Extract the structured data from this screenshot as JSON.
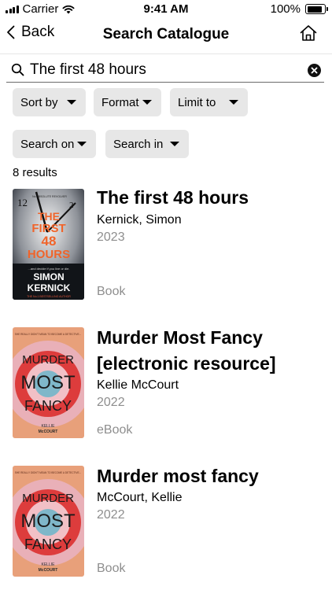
{
  "status_bar": {
    "carrier": "Carrier",
    "time": "9:41 AM",
    "battery": "100%",
    "battery_level": 1.0
  },
  "nav": {
    "back_label": "Back",
    "title": "Search Catalogue"
  },
  "search": {
    "value": "The first 48 hours",
    "placeholder": ""
  },
  "filters": {
    "sort_by": "Sort by",
    "format": "Format",
    "limit_to": "Limit to",
    "search_on": "Search on",
    "search_in": "Search in"
  },
  "results_count": "8 results",
  "results": [
    {
      "title": "The first 48 hours",
      "author": "Kernick, Simon",
      "year": "2023",
      "format": "Book",
      "cover": {
        "top_tagline": "No ABSOLUTE REVOLVER",
        "title_lines": [
          "THE",
          "FIRST",
          "48",
          "HOURS"
        ],
        "tagline": "...and decide if you live or die.",
        "author_lines": [
          "SIMON",
          "KERNICK"
        ],
        "footer": "THE No.1 BESTSELLING AUTHOR",
        "title_color": "#f0642a"
      }
    },
    {
      "title": "Murder Most Fancy [electronic resource]",
      "author": "Kellie McCourt",
      "year": "2022",
      "format": "eBook",
      "cover": {
        "top_tagline": "SHE REALLY DIDN'T MEAN TO BECOME A DETECTIVE...",
        "title_lines": [
          "MURDER",
          "MOST",
          "FANCY"
        ],
        "author_lines": [
          "KELLIE",
          "McCOURT"
        ]
      }
    },
    {
      "title": "Murder most fancy",
      "author": "McCourt, Kellie",
      "year": "2022",
      "format": "Book",
      "cover": {
        "top_tagline": "SHE REALLY DIDN'T MEAN TO BECOME A DETECTIVE...",
        "title_lines": [
          "MURDER",
          "MOST",
          "FANCY"
        ],
        "author_lines": [
          "KELLIE",
          "McCOURT"
        ]
      }
    }
  ]
}
